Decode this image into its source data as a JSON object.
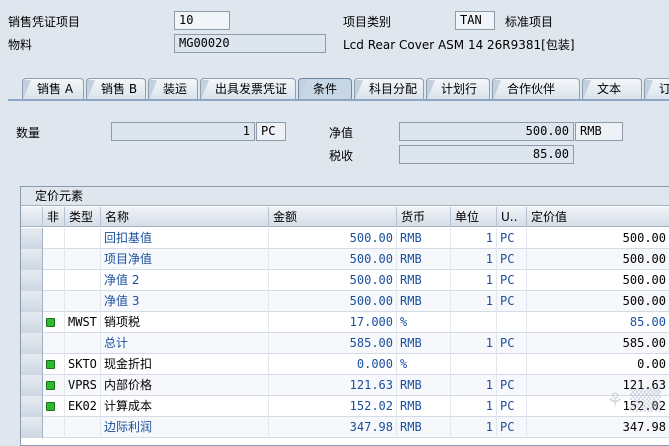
{
  "header": {
    "sales_doc_item_label": "销售凭证项目",
    "sales_doc_item_value": "10",
    "material_label": "物料",
    "material_value": "MG00020",
    "item_category_label": "项目类别",
    "item_category_value": "TAN",
    "item_category_desc": "标准项目",
    "material_desc": "Lcd Rear Cover ASM 14 26R9381[包装]"
  },
  "tabs": [
    {
      "label": "销售 A"
    },
    {
      "label": "销售 B"
    },
    {
      "label": "装运"
    },
    {
      "label": "出具发票凭证"
    },
    {
      "label": "条件"
    },
    {
      "label": "科目分配"
    },
    {
      "label": "计划行"
    },
    {
      "label": "合作伙伴"
    },
    {
      "label": "文本"
    },
    {
      "label": "订单"
    }
  ],
  "active_tab": "条件",
  "summary": {
    "quantity_label": "数量",
    "quantity_value": "1",
    "quantity_unit": "PC",
    "net_value_label": "净值",
    "net_value": "500.00",
    "net_value_currency": "RMB",
    "tax_label": "税收",
    "tax_value": "85.00"
  },
  "pricing": {
    "title": "定价元素",
    "columns": [
      "非",
      "类型",
      "名称",
      "金额",
      "货币",
      "单位",
      "U..",
      "定价值"
    ],
    "rows": [
      {
        "led": false,
        "type": "",
        "name": "回扣基值",
        "amount": "500.00",
        "currency": "RMB",
        "per": "1",
        "uom": "PC",
        "value": "500.00",
        "name_blue": true,
        "value_blue": false
      },
      {
        "led": false,
        "type": "",
        "name": "项目净值",
        "amount": "500.00",
        "currency": "RMB",
        "per": "1",
        "uom": "PC",
        "value": "500.00",
        "name_blue": true,
        "value_blue": false
      },
      {
        "led": false,
        "type": "",
        "name": "净值 2",
        "amount": "500.00",
        "currency": "RMB",
        "per": "1",
        "uom": "PC",
        "value": "500.00",
        "name_blue": true,
        "value_blue": false
      },
      {
        "led": false,
        "type": "",
        "name": "净值 3",
        "amount": "500.00",
        "currency": "RMB",
        "per": "1",
        "uom": "PC",
        "value": "500.00",
        "name_blue": true,
        "value_blue": false
      },
      {
        "led": true,
        "type": "MWST",
        "name": "销项税",
        "amount": "17.000",
        "currency": "%",
        "per": "",
        "uom": "",
        "value": "85.00",
        "name_blue": false,
        "value_blue": true
      },
      {
        "led": false,
        "type": "",
        "name": "总计",
        "amount": "585.00",
        "currency": "RMB",
        "per": "1",
        "uom": "PC",
        "value": "585.00",
        "name_blue": true,
        "value_blue": false
      },
      {
        "led": true,
        "type": "SKTO",
        "name": "现金折扣",
        "amount": "0.000",
        "currency": "%",
        "per": "",
        "uom": "",
        "value": "0.00",
        "name_blue": false,
        "value_blue": false
      },
      {
        "led": true,
        "type": "VPRS",
        "name": "内部价格",
        "amount": "121.63",
        "currency": "RMB",
        "per": "1",
        "uom": "PC",
        "value": "121.63",
        "name_blue": false,
        "value_blue": false
      },
      {
        "led": true,
        "type": "EK02",
        "name": "计算成本",
        "amount": "152.02",
        "currency": "RMB",
        "per": "1",
        "uom": "PC",
        "value": "152.02",
        "name_blue": false,
        "value_blue": false
      },
      {
        "led": false,
        "type": "",
        "name": "边际利润",
        "amount": "347.98",
        "currency": "RMB",
        "per": "1",
        "uom": "PC",
        "value": "347.98",
        "name_blue": true,
        "value_blue": false
      }
    ]
  },
  "colors": {
    "background": "#dfe6ee",
    "field": "#dde5ee",
    "blue_text": "#1a4f9c",
    "led_green": "#2dbb2d"
  },
  "icons": {
    "condition_status": "green-square-icon"
  }
}
